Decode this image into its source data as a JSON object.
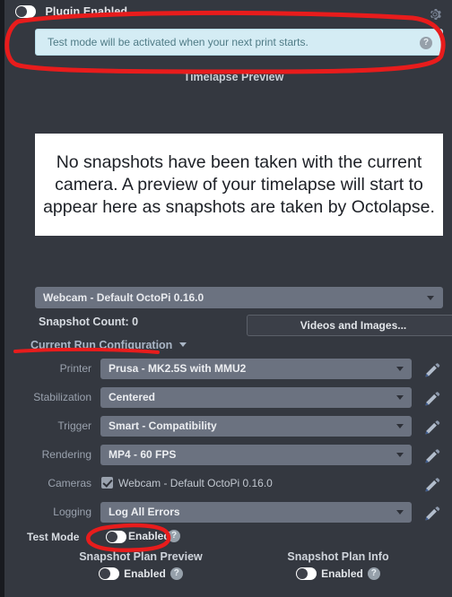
{
  "header": {
    "plugin_toggle_label": "Plugin Enabled",
    "plugin_toggle_state": "off",
    "gear_icon": "gear-icon"
  },
  "alert": {
    "message": "Test mode will be activated when your next print starts.",
    "help_icon": "question-circle-icon",
    "bg_color": "#d4ecf4",
    "text_color": "#4f7b86"
  },
  "timelapse": {
    "title": "Timelapse Preview",
    "empty_message": "No snapshots have been taken with the current camera. A preview of your timelapse will start to appear here as snapshots are taken by Octolapse."
  },
  "camera": {
    "selected": "Webcam - Default OctoPi 0.16.0"
  },
  "snapshot": {
    "count_label": "Snapshot Count:  0",
    "videos_button": "Videos and Images..."
  },
  "current_run": {
    "title": "Current Run Configuration",
    "rows": [
      {
        "label": "Printer",
        "value": "Prusa - MK2.5S with MMU2",
        "type": "select",
        "edit_icon": "pencil-icon"
      },
      {
        "label": "Stabilization",
        "value": "Centered",
        "type": "select",
        "edit_icon": "pencil-icon"
      },
      {
        "label": "Trigger",
        "value": "Smart - Compatibility",
        "type": "select",
        "edit_icon": "pencil-icon"
      },
      {
        "label": "Rendering",
        "value": "MP4 - 60 FPS",
        "type": "select",
        "edit_icon": "pencil-icon"
      },
      {
        "label": "Cameras",
        "value": "Webcam - Default OctoPi 0.16.0",
        "type": "checkbox",
        "checked": true,
        "edit_icon": "pencil-icon"
      },
      {
        "label": "Logging",
        "value": "Log All Errors",
        "type": "select",
        "edit_icon": "pencil-icon"
      }
    ]
  },
  "test_mode": {
    "label": "Test Mode",
    "toggle_state": "on",
    "state_label": "Enabled",
    "help_icon": "question-circle-icon"
  },
  "bottom": {
    "left": {
      "title": "Snapshot Plan Preview",
      "state_label": "Enabled",
      "toggle_state": "on",
      "help_icon": "question-circle-icon"
    },
    "right": {
      "title": "Snapshot Plan Info",
      "state_label": "Enabled",
      "toggle_state": "on",
      "help_icon": "question-circle-icon"
    }
  },
  "annotations": {
    "color": "#e81c1c",
    "shapes": [
      "ellipse-around-alert",
      "underline-current-run-configuration",
      "ellipse-around-test-mode-toggle"
    ]
  },
  "colors": {
    "panel_bg": "#343840",
    "field_bg": "#6b7280",
    "accent_link": "#aab6c6",
    "annotation_red": "#e81c1c"
  }
}
